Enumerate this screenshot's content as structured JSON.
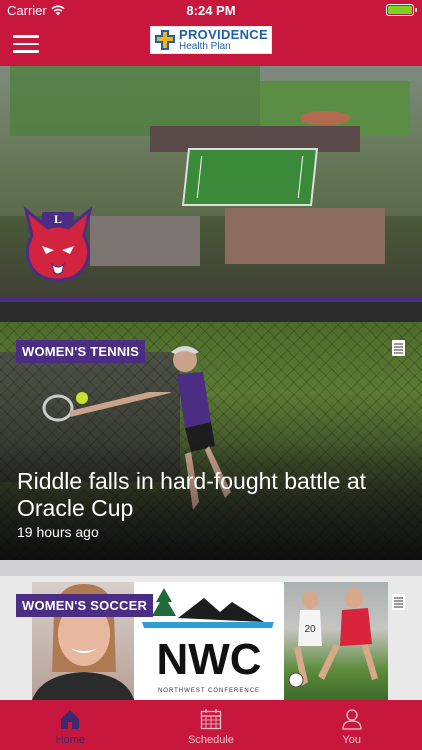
{
  "status_bar": {
    "carrier": "Carrier",
    "time": "8:24 PM",
    "battery_color": "#7ed321"
  },
  "header": {
    "background_color": "#c8173c",
    "menu_icon": "hamburger-icon",
    "sponsor_logo": {
      "line1": "PROVIDENCE",
      "line2": "Health Plan"
    }
  },
  "hero": {
    "mascot_letter": "L"
  },
  "feed": [
    {
      "category": "WOMEN'S TENNIS",
      "headline": "Riddle falls in hard-fought battle at Oracle Cup",
      "time_ago": "19 hours ago",
      "icon": "article-icon"
    },
    {
      "category": "WOMEN'S SOCCER",
      "icon": "article-icon",
      "logo_text": "NWC",
      "logo_subtext": "NORTHWEST CONFERENCE"
    }
  ],
  "tabs": [
    {
      "label": "Home",
      "icon": "home-icon",
      "active": true
    },
    {
      "label": "Schedule",
      "icon": "calendar-icon",
      "active": false
    },
    {
      "label": "You",
      "icon": "user-icon",
      "active": false
    }
  ],
  "colors": {
    "brand_red": "#c8173c",
    "badge_purple": "#4b2e83",
    "active_tab": "#3d2a6e"
  }
}
